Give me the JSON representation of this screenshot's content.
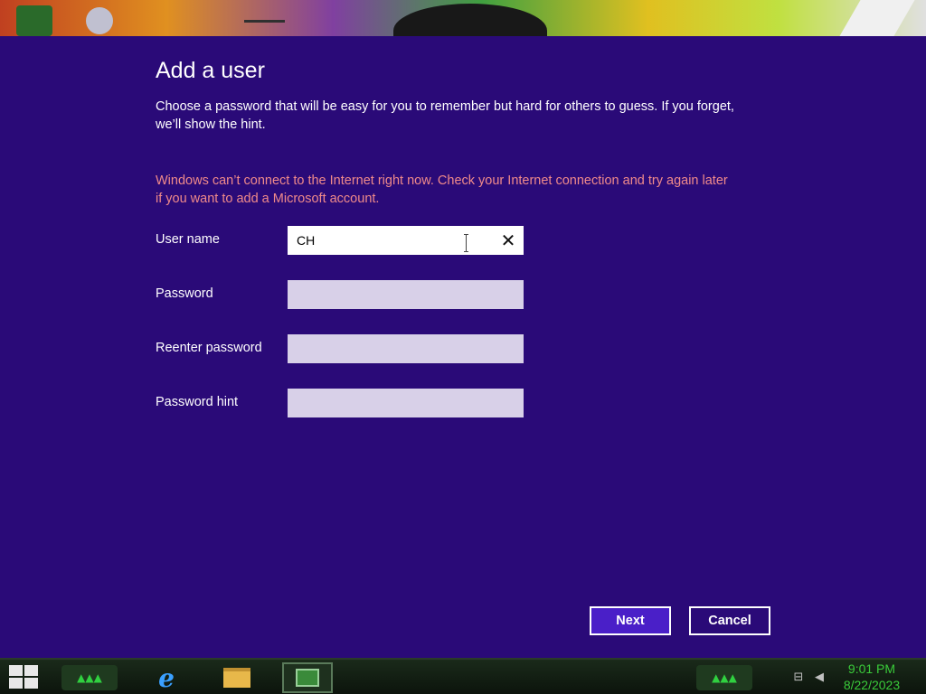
{
  "dialog": {
    "title": "Add a user",
    "instructions": "Choose a password that will be easy for you to remember but hard for others to guess. If you forget, we’ll show the hint.",
    "error": "Windows can’t connect to the Internet right now. Check your Internet connection and try again later if you want to add a Microsoft account.",
    "fields": {
      "username": {
        "label": "User name",
        "value": "CH"
      },
      "password": {
        "label": "Password",
        "value": ""
      },
      "reenter": {
        "label": "Reenter password",
        "value": ""
      },
      "hint": {
        "label": "Password hint",
        "value": ""
      }
    },
    "clear_glyph": "✕",
    "buttons": {
      "next": "Next",
      "cancel": "Cancel"
    }
  },
  "taskbar": {
    "decor_glyph": "▲▲▲",
    "tray_glyphs": {
      "network": "⊟",
      "volume": "◀"
    },
    "clock": {
      "time": "9:01 PM",
      "date": "8/22/2023"
    }
  },
  "colors": {
    "dialog_background": "#2a0a78",
    "error_text": "#f08a8a",
    "primary_button": "#4a1fc8",
    "clock_text": "#3acb3a"
  }
}
